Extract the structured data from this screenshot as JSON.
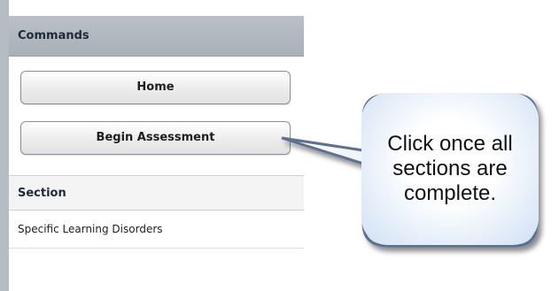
{
  "commands": {
    "title": "Commands",
    "buttons": [
      {
        "label": "Home"
      },
      {
        "label": "Begin Assessment"
      }
    ]
  },
  "sections": {
    "header": "Section",
    "rows": [
      {
        "label": "Specific Learning Disorders"
      }
    ]
  },
  "callout": {
    "text": "Click once all sections are complete."
  },
  "colors": {
    "header_bg": "#b0b7be",
    "callout_border": "#5c7190",
    "callout_fill": "#dbe7f5"
  }
}
